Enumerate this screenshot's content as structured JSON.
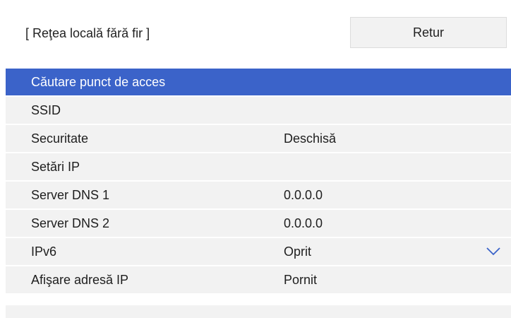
{
  "header": {
    "title": "[ Reţea locală fără fir ]",
    "back_label": "Retur"
  },
  "menu": {
    "selected_index": 0,
    "items": [
      {
        "label": "Căutare punct de acces",
        "value": ""
      },
      {
        "label": "SSID",
        "value": ""
      },
      {
        "label": "Securitate",
        "value": "Deschisă"
      },
      {
        "label": "Setări IP",
        "value": ""
      },
      {
        "label": "Server DNS 1",
        "value": "0.0.0.0"
      },
      {
        "label": "Server DNS 2",
        "value": "0.0.0.0"
      },
      {
        "label": "IPv6",
        "value": "Oprit"
      },
      {
        "label": "Afişare adresă IP",
        "value": "Pornit"
      }
    ]
  },
  "icons": {
    "scroll_indicator": "chevron-down-icon"
  },
  "colors": {
    "selection": "#3b63c9",
    "row_background": "#f2f2f2",
    "text": "#1e1e1e"
  }
}
